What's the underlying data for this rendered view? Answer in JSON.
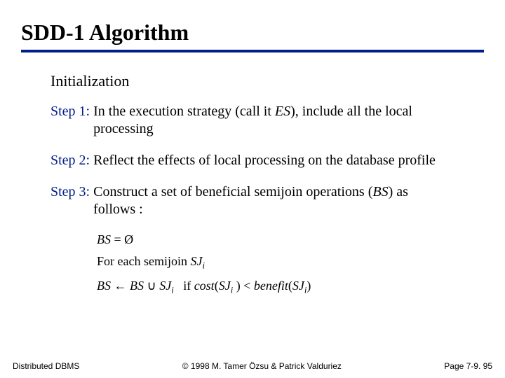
{
  "title": "SDD-1 Algorithm",
  "section": "Initialization",
  "steps": [
    {
      "label": "Step 1:",
      "body_html": "In the execution strategy (call it <span class='ital'>ES</span>), include all the local processing"
    },
    {
      "label": "Step 2:",
      "body_html": "Reflect the effects of local processing on the database profile"
    },
    {
      "label": "Step 3:",
      "body_html": "Construct a set of beneficial semijoin operations (<span class='ital'>BS</span>) as follows :"
    }
  ],
  "formula": {
    "line1_html": "<span class='ital'>BS</span> = Ø",
    "line2_html": "For each semijoin <span class='ital'>SJ</span><span class='sub'>i</span>",
    "line3_html": "<span class='ital'>BS</span> ← <span class='ital'>BS</span> ∪ <span class='ital'>SJ</span><span class='sub'>i</span>&nbsp;&nbsp; if <span class='ital'>cost</span>(<span class='ital'>SJ</span><span class='sub'>i</span> ) &lt; <span class='ital'>benefit</span>(<span class='ital'>SJ</span><span class='sub'>i</span>)"
  },
  "footer": {
    "left": "Distributed DBMS",
    "center": "© 1998 M. Tamer Özsu & Patrick Valduriez",
    "right": "Page 7-9. 95"
  }
}
